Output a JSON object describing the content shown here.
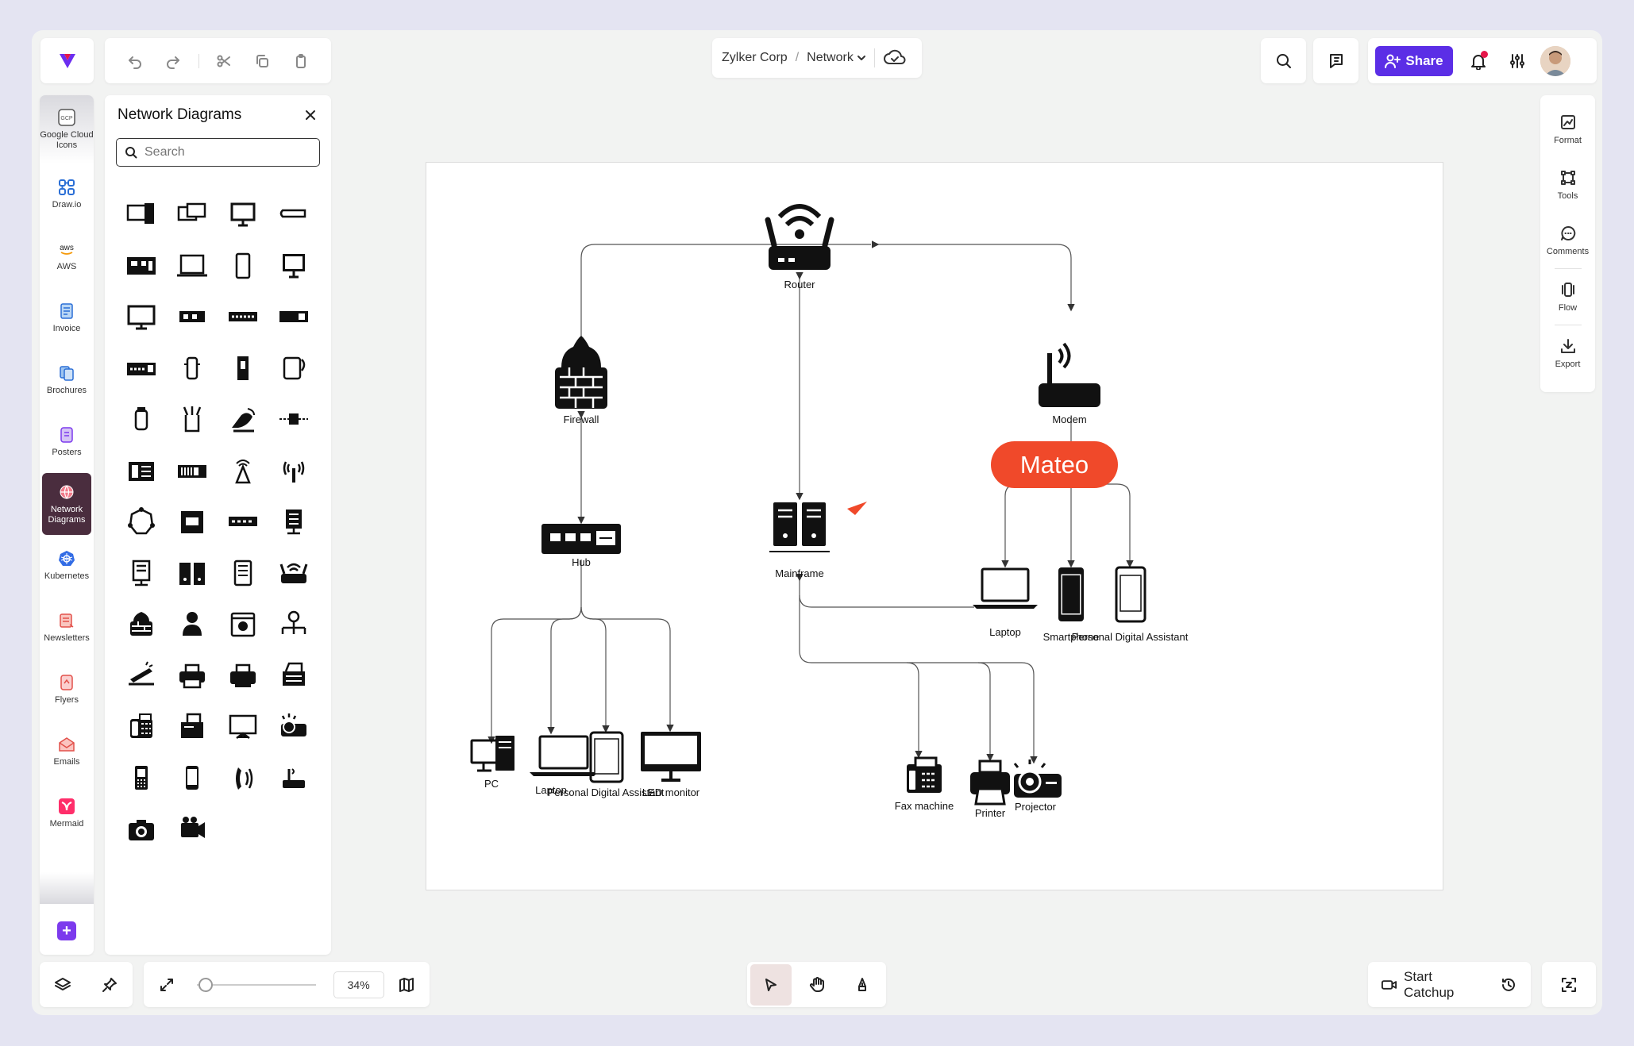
{
  "breadcrumb": {
    "org": "Zylker Corp",
    "separator": "/",
    "page": "Network"
  },
  "header": {
    "share_label": "Share"
  },
  "colors": {
    "accent": "#5b2ee6",
    "cursor_tag": "#f0492a",
    "active_rail": "#4a2d3e",
    "notification": "#e6164a"
  },
  "rail": {
    "items": [
      {
        "label": "Google Cloud Icons",
        "icon": "gcp-icon"
      },
      {
        "label": "Draw.io",
        "icon": "drawio-icon"
      },
      {
        "label": "AWS",
        "icon": "aws-icon"
      },
      {
        "label": "Invoice",
        "icon": "invoice-icon"
      },
      {
        "label": "Brochures",
        "icon": "brochures-icon"
      },
      {
        "label": "Posters",
        "icon": "posters-icon"
      },
      {
        "label": "Network Diagrams",
        "icon": "network-icon"
      },
      {
        "label": "Kubernetes",
        "icon": "kubernetes-icon"
      },
      {
        "label": "Newsletters",
        "icon": "newsletters-icon"
      },
      {
        "label": "Flyers",
        "icon": "flyers-icon"
      },
      {
        "label": "Emails",
        "icon": "emails-icon"
      },
      {
        "label": "Mermaid",
        "icon": "mermaid-icon"
      }
    ],
    "gcp_badge": "GCP",
    "aws_badge": "aws"
  },
  "panel": {
    "title": "Network Diagrams",
    "search_placeholder": "Search"
  },
  "right_panel": {
    "format": "Format",
    "tools": "Tools",
    "comments": "Comments",
    "flow": "Flow",
    "export": "Export"
  },
  "diagram": {
    "nodes": {
      "router": "Router",
      "firewall": "Firewall",
      "modem": "Modem",
      "hub": "Hub",
      "mainframe": "Mainframe",
      "laptop_right": "Laptop",
      "smartphone": "Smartphone",
      "pda_right": "Personal Digital Assistant",
      "pc": "PC",
      "laptop_left": "Laptop",
      "pda_left": "Personal Digital Assistant",
      "led_monitor": "LED monitor",
      "fax": "Fax machine",
      "printer": "Printer",
      "projector": "Projector"
    },
    "collaborator": "Mateo"
  },
  "bottom": {
    "zoom": "34%",
    "catchup": "Start Catchup"
  }
}
